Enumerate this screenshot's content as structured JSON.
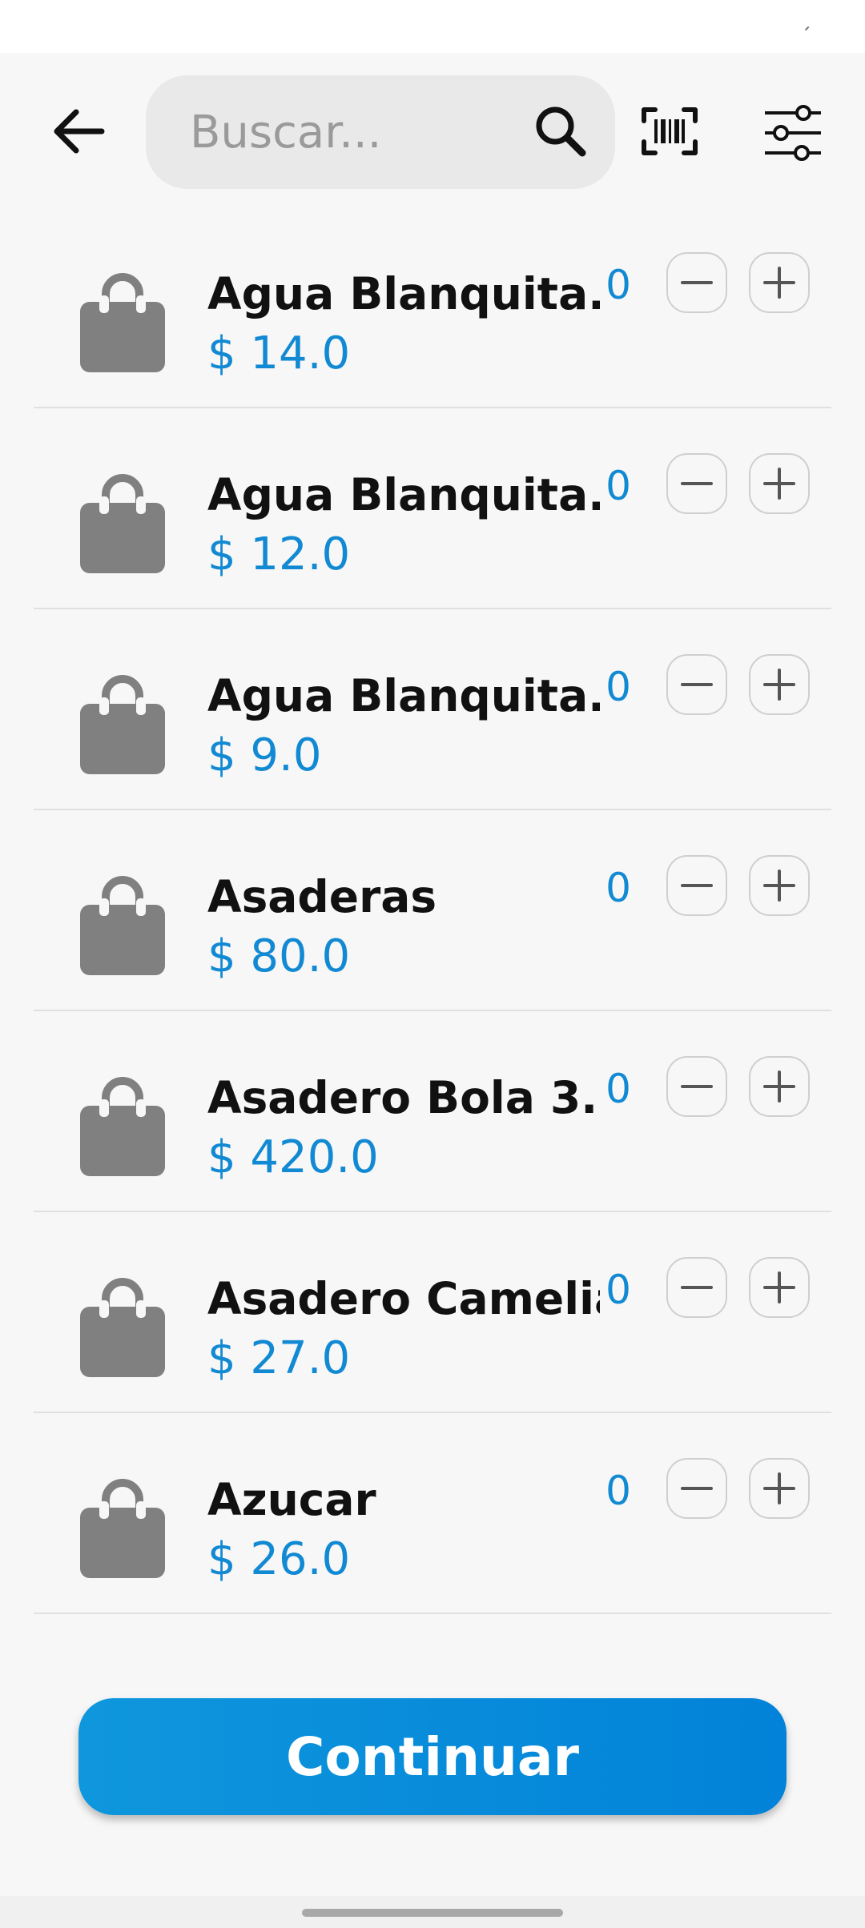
{
  "search": {
    "placeholder": "Buscar..."
  },
  "icons": {
    "back": "arrow-left-icon",
    "search": "search-icon",
    "barcode": "barcode-scan-icon",
    "filter": "sliders-icon",
    "product": "shopping-bag-icon",
    "minus": "minus-icon",
    "plus": "plus-icon"
  },
  "colors": {
    "accent": "#1289d3",
    "button": "#0b8fdb",
    "bag_icon": "#808080",
    "background": "#f7f7f7"
  },
  "products": [
    {
      "name": "Agua Blanquita...",
      "price": "$ 14.0",
      "qty": "0"
    },
    {
      "name": "Agua Blanquita...",
      "price": "$ 12.0",
      "qty": "0"
    },
    {
      "name": "Agua Blanquita...",
      "price": "$ 9.0",
      "qty": "0"
    },
    {
      "name": "Asaderas",
      "price": "$ 80.0",
      "qty": "0"
    },
    {
      "name": "Asadero Bola 3...",
      "price": "$ 420.0",
      "qty": "0"
    },
    {
      "name": "Asadero Camelia",
      "price": "$ 27.0",
      "qty": "0"
    },
    {
      "name": "Azucar",
      "price": "$ 26.0",
      "qty": "0"
    }
  ],
  "continue_label": "Continuar"
}
